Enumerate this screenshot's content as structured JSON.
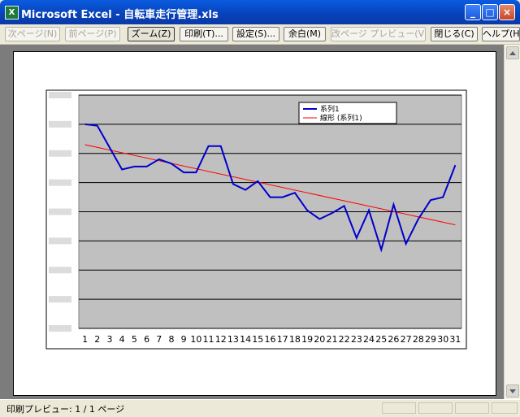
{
  "window": {
    "title": "Microsoft Excel - 自転車走行管理.xls",
    "app_icon": "excel-icon",
    "minimize_glyph": "_",
    "maximize_glyph": "□",
    "close_glyph": "×"
  },
  "toolbar": {
    "next_page": "次ページ(N)",
    "prev_page": "前ページ(P)",
    "zoom": "ズーム(Z)",
    "print": "印刷(T)...",
    "setup": "設定(S)...",
    "margins": "余白(M)",
    "page_break_preview": "改ページ プレビュー(V)",
    "close": "閉じる(C)",
    "help": "ヘルプ(H)"
  },
  "status": {
    "text": "印刷プレビュー: 1 / 1 ページ"
  },
  "chart_data": {
    "type": "line",
    "x": [
      "1",
      "2",
      "3",
      "4",
      "5",
      "6",
      "7",
      "8",
      "9",
      "10",
      "11",
      "12",
      "13",
      "14",
      "15",
      "16",
      "17",
      "18",
      "19",
      "20",
      "21",
      "22",
      "23",
      "24",
      "25",
      "26",
      "27",
      "28",
      "29",
      "30",
      "31"
    ],
    "series": [
      {
        "name": "系列1",
        "color": "#0000cc",
        "values": [
          7.0,
          6.95,
          6.2,
          5.45,
          5.55,
          5.55,
          5.8,
          5.65,
          5.35,
          5.35,
          6.25,
          6.25,
          4.95,
          4.75,
          5.05,
          4.5,
          4.5,
          4.65,
          4.05,
          3.75,
          3.95,
          4.2,
          3.1,
          4.05,
          2.7,
          4.25,
          2.9,
          3.75,
          4.4,
          4.5,
          5.6
        ]
      }
    ],
    "trendline": {
      "name": "線形 (系列1)",
      "color": "#ff0000",
      "start": 6.3,
      "end": 3.55
    },
    "ylim": [
      0,
      8
    ],
    "y_ticks": [
      "",
      "",
      "",
      "",
      "",
      "",
      "",
      "",
      ""
    ],
    "grid": true,
    "plot_background": "#c0c0c0",
    "legend_position": "top-right"
  }
}
